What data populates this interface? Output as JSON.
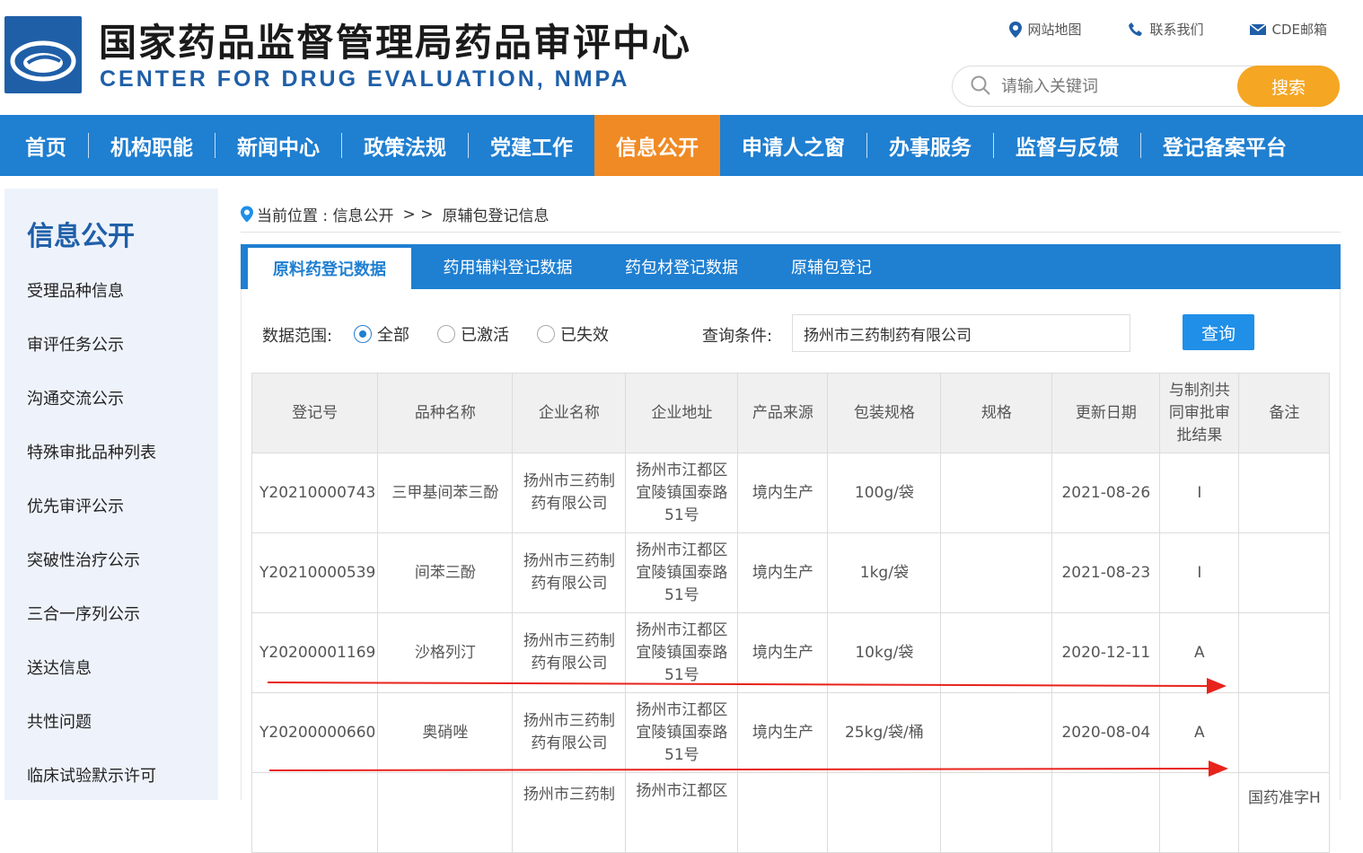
{
  "site": {
    "title_cn": "国家药品监督管理局药品审评中心",
    "title_en": "CENTER FOR DRUG EVALUATION, NMPA"
  },
  "top_links": [
    "网站地图",
    "联系我们",
    "CDE邮箱"
  ],
  "search": {
    "placeholder": "请输入关键词",
    "button": "搜索"
  },
  "nav": [
    "首页",
    "机构职能",
    "新闻中心",
    "政策法规",
    "党建工作",
    "信息公开",
    "申请人之窗",
    "办事服务",
    "监督与反馈",
    "登记备案平台"
  ],
  "nav_active": 5,
  "sidebar": {
    "title": "信息公开",
    "items": [
      "受理品种信息",
      "审评任务公示",
      "沟通交流公示",
      "特殊审批品种列表",
      "优先审评公示",
      "突破性治疗公示",
      "三合一序列公示",
      "送达信息",
      "共性问题",
      "临床试验默示许可"
    ]
  },
  "breadcrumb": {
    "prefix": "当前位置 : 信息公开",
    "sep": "> >",
    "current": "原辅包登记信息"
  },
  "tabs": [
    "原料药登记数据",
    "药用辅料登记数据",
    "药包材登记数据",
    "原辅包登记"
  ],
  "filter": {
    "range_label": "数据范围:",
    "options": [
      "全部",
      "已激活",
      "已失效"
    ],
    "selected": 0,
    "condition_label": "查询条件:",
    "condition_value": "扬州市三药制药有限公司",
    "query_button": "查询"
  },
  "table": {
    "headers": [
      "登记号",
      "品种名称",
      "企业名称",
      "企业地址",
      "产品来源",
      "包装规格",
      "规格",
      "更新日期",
      "与制剂共同审批审批结果",
      "备注"
    ],
    "rows": [
      [
        "Y20210000743",
        "三甲基间苯三酚",
        "扬州市三药制药有限公司",
        "扬州市江都区宜陵镇国泰路51号",
        "境内生产",
        "100g/袋",
        "",
        "2021-08-26",
        "I",
        ""
      ],
      [
        "Y20210000539",
        "间苯三酚",
        "扬州市三药制药有限公司",
        "扬州市江都区宜陵镇国泰路51号",
        "境内生产",
        "1kg/袋",
        "",
        "2021-08-23",
        "I",
        ""
      ],
      [
        "Y20200001169",
        "沙格列汀",
        "扬州市三药制药有限公司",
        "扬州市江都区宜陵镇国泰路51号",
        "境内生产",
        "10kg/袋",
        "",
        "2020-12-11",
        "A",
        ""
      ],
      [
        "Y20200000660",
        "奥硝唑",
        "扬州市三药制药有限公司",
        "扬州市江都区宜陵镇国泰路51号",
        "境内生产",
        "25kg/袋/桶",
        "",
        "2020-08-04",
        "A",
        ""
      ],
      [
        "",
        "",
        "扬州市三药制",
        "扬州市江都区",
        "",
        "",
        "",
        "",
        "",
        "国药准字H"
      ]
    ]
  },
  "colors": {
    "nav_blue": "#1f7fd1",
    "nav_active": "#f08a24",
    "search_btn": "#f5a623",
    "arrow": "#e8231c"
  }
}
